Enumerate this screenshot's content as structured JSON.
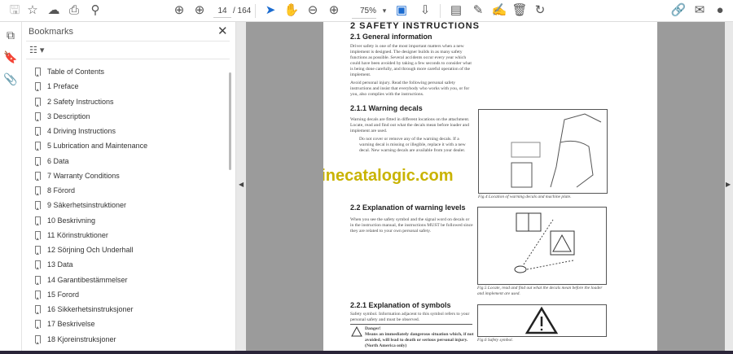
{
  "toolbar": {
    "page_current": "14",
    "page_total": "/ 164",
    "zoom": "75%"
  },
  "bookmarks": {
    "title": "Bookmarks",
    "items": [
      "Table of Contents",
      "1 Preface",
      "2 Safety Instructions",
      "3 Description",
      "4 Driving Instructions",
      "5 Lubrication and Maintenance",
      "6 Data",
      "7 Warranty Conditions",
      "8 Förord",
      "9 Säkerhetsinstruktioner",
      "10 Beskrivning",
      "11 Körinstruktioner",
      "12 Sörjning Och Underhall",
      "13 Data",
      "14 Garantibestämmelser",
      "15 Forord",
      "16 Sikkerhetsinstruksjoner",
      "17 Beskrivelse",
      "18 Kjoreinstruksjoner"
    ]
  },
  "document": {
    "chapter": "2 SAFETY INSTRUCTIONS",
    "s21": "2.1 General information",
    "s21_text": "Driver safety is one of the most important matters when a new implement is designed. The designer builds in as many safety functions as possible. Several accidents occur every year which could have been avoided by taking a few seconds to consider what is being done carefully, and through more careful operation of the implement.",
    "s21_text2": "Avoid personal injury. Read the following personal safety instructions and insist that everybody who works with you, or for you, also complies with the instructions.",
    "s211": "2.1.1 Warning decals",
    "s211_text": "Warning decals are fitted in different locations on the attachment. Locate, read and find out what the decals mean before loader and implement are used.",
    "s211_bullet": "Do not cover or remove any of the warning decals. If a warning decal is missing or illegible, replace it with a new decal. New warning decals are available from your dealer.",
    "fig4": "Fig.4 Location of warning decals and machine plate.",
    "s22": "2.2 Explanation of warning levels",
    "s22_text": "When you see the safety symbol and the signal word on decals or in the instruction manual, the instructions MUST be followed since they are related to your own personal safety.",
    "fig5": "Fig.5 Locate, read and find out what the decals mean before the loader and implement are used.",
    "s221": "2.2.1 Explanation of symbols",
    "s221_text": "Safety symbol. Information adjacent to this symbol refers to your personal safety and must be observed.",
    "danger_title": "Danger!",
    "danger_text": "Means an immediately dangerous situation which, if not avoided, will lead to death or serious personal injury. (North America only)",
    "fig6": "Fig.6 Safety symbol.",
    "watermark": "machinecatalogic.com"
  }
}
